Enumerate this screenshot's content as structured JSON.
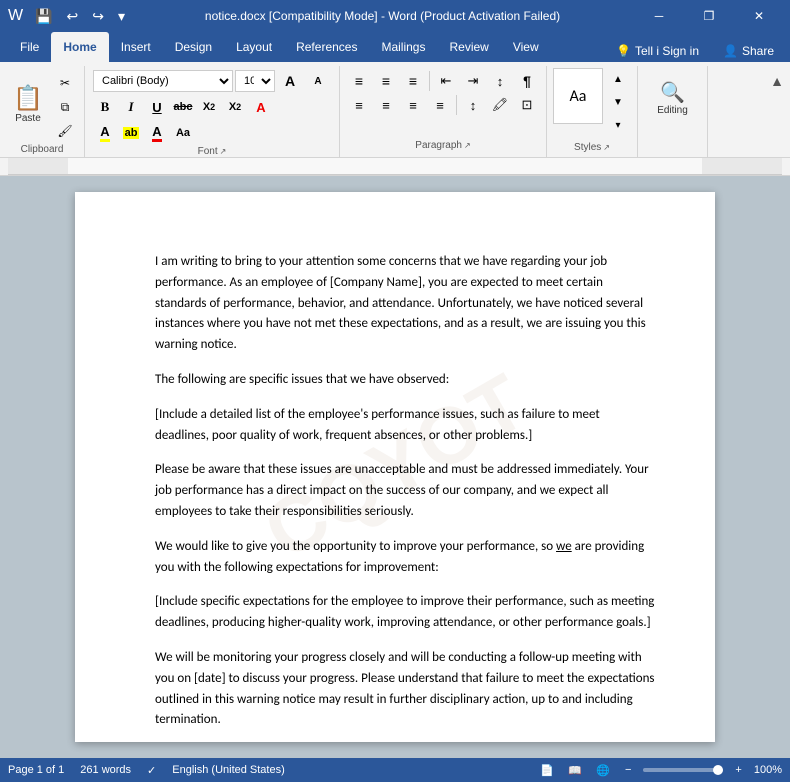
{
  "titleBar": {
    "title": "notice.docx [Compatibility Mode] - Word (Product Activation Failed)",
    "saveIcon": "💾",
    "undoIcon": "↩",
    "redoIcon": "↪",
    "dropdownIcon": "▾",
    "minimizeLabel": "─",
    "restoreLabel": "❐",
    "closeLabel": "✕",
    "restoreIcon": "⧉"
  },
  "ribbonTabs": [
    {
      "label": "File",
      "active": false
    },
    {
      "label": "Home",
      "active": true
    },
    {
      "label": "Insert",
      "active": false
    },
    {
      "label": "Design",
      "active": false
    },
    {
      "label": "Layout",
      "active": false
    },
    {
      "label": "References",
      "active": false
    },
    {
      "label": "Mailings",
      "active": false
    },
    {
      "label": "Review",
      "active": false
    },
    {
      "label": "View",
      "active": false
    }
  ],
  "ribbonRight": {
    "tellMeLabel": "Tell i Sign in",
    "shareLabel": "Share",
    "helpIcon": "💡"
  },
  "clipboard": {
    "pasteLabel": "Paste",
    "cutLabel": "✂",
    "copyLabel": "⧉",
    "formatPainterLabel": "🖌",
    "groupLabel": "Clipboard"
  },
  "font": {
    "fontName": "Calibri (Body)",
    "fontSize": "10",
    "boldLabel": "B",
    "italicLabel": "I",
    "underlineLabel": "U",
    "strikeLabel": "abc",
    "subscriptLabel": "X₂",
    "superscriptLabel": "X²",
    "clearLabel": "A",
    "fontColorLabel": "A",
    "highlightLabel": "ab",
    "textColorLabel": "A",
    "caseLabel": "Aa",
    "growLabel": "A",
    "shrinkLabel": "A",
    "groupLabel": "Font",
    "expandIcon": "↗"
  },
  "paragraph": {
    "listBulletLabel": "≡",
    "listNumberLabel": "≡",
    "listMultiLabel": "≡",
    "decreaseIndentLabel": "⇤",
    "increaseIndentLabel": "⇥",
    "sortLabel": "↕",
    "showHideLabel": "¶",
    "alignLeftLabel": "≡",
    "centerLabel": "≡",
    "alignRightLabel": "≡",
    "justifyLabel": "≡",
    "lineSpacingLabel": "↕",
    "shadingLabel": "🖍",
    "borderLabel": "⊡",
    "groupLabel": "Paragraph",
    "expandIcon": "↗"
  },
  "styles": {
    "previewLabel": "Aa",
    "groupLabel": "Styles",
    "expandIcon": "↗"
  },
  "editing": {
    "icon": "🔍",
    "label": "Editing",
    "expandIcon": "▾"
  },
  "document": {
    "paragraphs": [
      "I am writing to bring to your attention some concerns that we have regarding your job performance. As an employee of [Company Name], you are expected to meet certain standards of performance, behavior, and attendance. Unfortunately, we have noticed several instances where you have not met these expectations, and as a result, we are issuing you this warning notice.",
      "The following are specific issues that we have observed:",
      "[Include a detailed list of the employee's performance issues, such as failure to meet deadlines, poor quality of work, frequent absences, or other problems.]",
      "Please be aware that these issues are unacceptable and must be addressed immediately. Your job performance has a direct impact on the success of our company, and we expect all employees to take their responsibilities seriously.",
      "We would like to give you the opportunity to improve your performance, so we are providing you with the following expectations for improvement:",
      "[Include specific expectations for the employee to improve their performance, such as meeting deadlines, producing higher-quality work, improving attendance, or other performance goals.]",
      "We will be monitoring your progress closely and will be conducting a follow-up meeting with you on [date] to discuss your progress. Please understand that failure to meet the expectations outlined in this warning notice may result in further disciplinary action, up to and including termination."
    ],
    "underlineText": "we"
  },
  "statusBar": {
    "pageInfo": "Page 1 of 1",
    "wordCount": "261 words",
    "proofIcon": "✓",
    "langLabel": "English (United States)",
    "viewPrintIcon": "📄",
    "viewWebIcon": "🌐",
    "viewReadIcon": "📖",
    "zoomPercent": "100%",
    "zoomMinusLabel": "−",
    "zoomPlusLabel": "+"
  }
}
